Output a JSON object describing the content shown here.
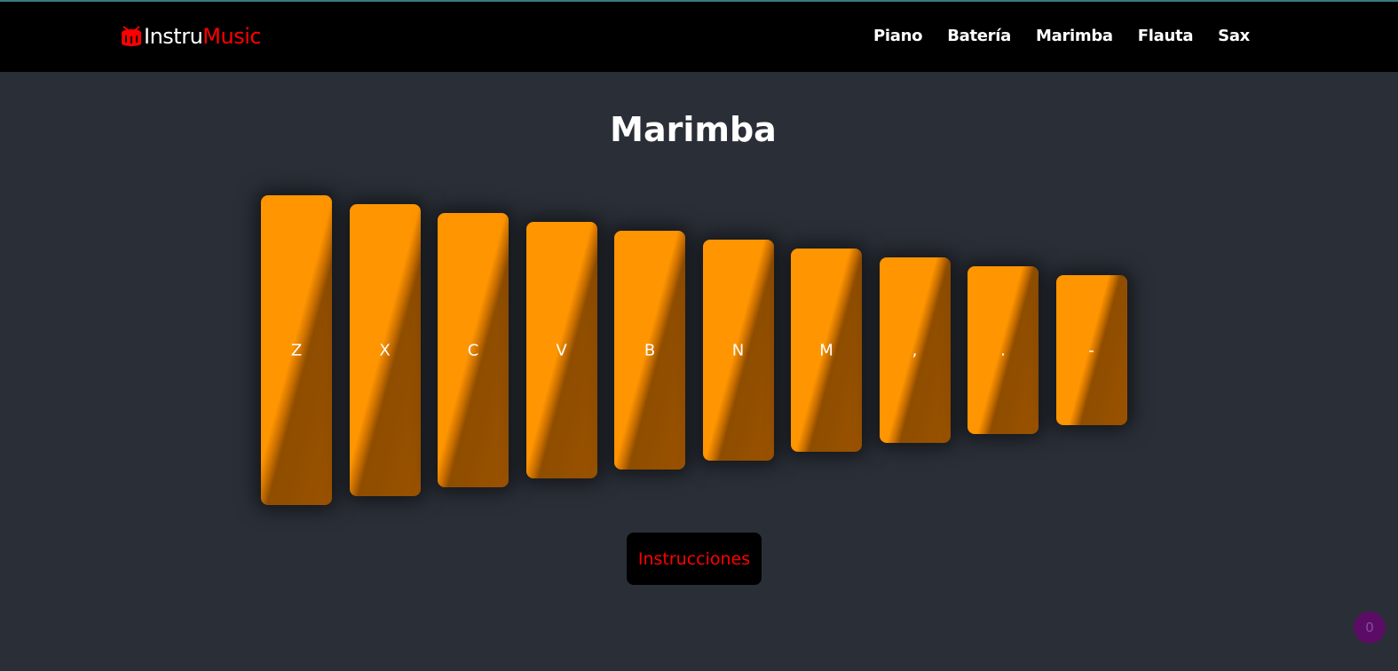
{
  "brand": {
    "part1": "Instru",
    "part2": "Music",
    "icon": "drum-icon",
    "accent": "#ff0000"
  },
  "nav": [
    "Piano",
    "Batería",
    "Marimba",
    "Flauta",
    "Sax"
  ],
  "page_title": "Marimba",
  "bars": {
    "keys": [
      "Z",
      "X",
      "C",
      "V",
      "B",
      "N",
      "M",
      ",",
      ".",
      "-"
    ],
    "color": "#ff9500"
  },
  "instructions_button": "Instrucciones",
  "counter_badge": "0"
}
